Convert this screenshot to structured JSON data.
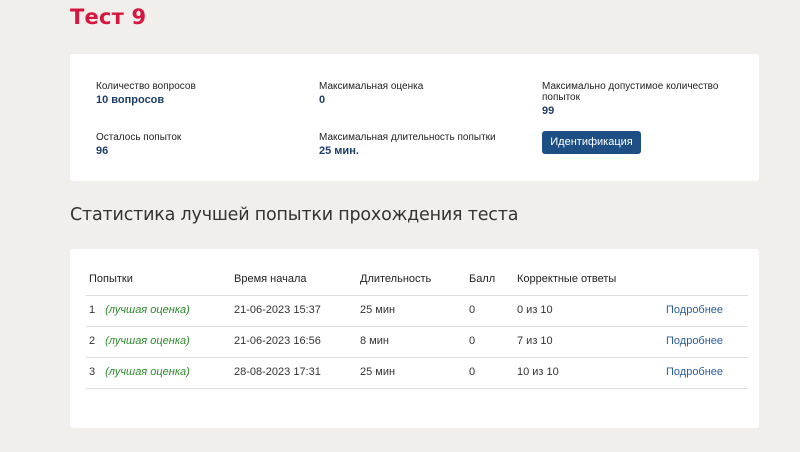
{
  "page": {
    "title": "Тест 9"
  },
  "info": {
    "questions_label": "Количество вопросов",
    "questions_value": "10 вопросов",
    "max_score_label": "Максимальная оценка",
    "max_score_value": "0",
    "max_attempts_label": "Максимально допустимое количество попыток",
    "max_attempts_value": "99",
    "attempts_left_label": "Осталось попыток",
    "attempts_left_value": "96",
    "max_duration_label": "Максимальная длительность попытки",
    "max_duration_value": "25 мин.",
    "identify_button": "Идентификация"
  },
  "stats": {
    "title": "Статистика лучшей попытки прохождения теста",
    "headers": {
      "attempts": "Попытки",
      "start_time": "Время начала",
      "duration": "Длительность",
      "score": "Балл",
      "correct": "Корректные ответы"
    },
    "rows": [
      {
        "num": "1",
        "tag": "(лучшая оценка)",
        "start": "21-06-2023 15:37",
        "duration": "25 мин",
        "score": "0",
        "correct": "0 из 10",
        "link": "Подробнее"
      },
      {
        "num": "2",
        "tag": "(лучшая оценка)",
        "start": "21-06-2023 16:56",
        "duration": "8 мин",
        "score": "0",
        "correct": "7 из 10",
        "link": "Подробнее"
      },
      {
        "num": "3",
        "tag": "(лучшая оценка)",
        "start": "28-08-2023 17:31",
        "duration": "25 мин",
        "score": "0",
        "correct": "10 из 10",
        "link": "Подробнее"
      }
    ]
  },
  "colors": {
    "title_red": "#d5173f",
    "value_blue": "#1f3f6b",
    "button_blue": "#1d4f85",
    "best_green": "#2b8a2b",
    "link_blue": "#2b5d9b",
    "background": "#f0efec"
  }
}
